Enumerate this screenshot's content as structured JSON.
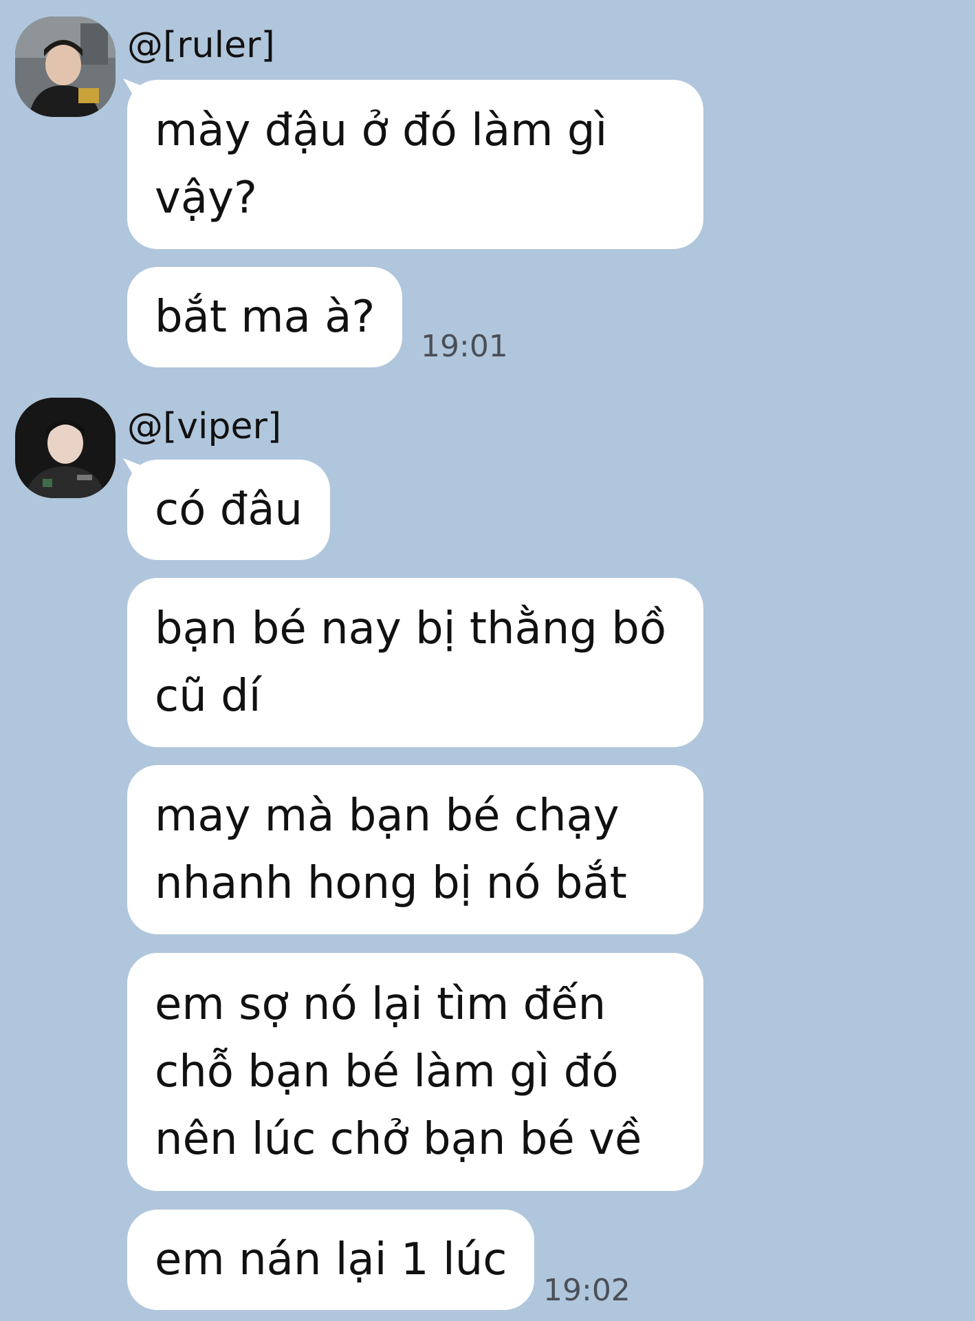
{
  "conversation": {
    "groups": [
      {
        "sender": "@[ruler]",
        "avatar_icon": "user-avatar-photo",
        "messages": [
          "mày đậu ở đó làm gì vậy?",
          "bắt ma à?"
        ],
        "time": "19:01"
      },
      {
        "sender": "@[viper]",
        "avatar_icon": "user-avatar-photo",
        "messages": [
          "có đâu",
          "bạn bé nay bị thằng bồ cũ dí",
          "may mà bạn bé chạy nhanh hong bị nó bắt",
          "em sợ nó lại tìm đến chỗ bạn bé làm gì đó nên lúc chở bạn bé về",
          "em nán lại 1 lúc"
        ],
        "time": "19:02"
      }
    ]
  },
  "colors": {
    "background": "#b0c6dc",
    "bubble": "#ffffff",
    "text": "#111111",
    "timestamp": "#4a4f57"
  }
}
